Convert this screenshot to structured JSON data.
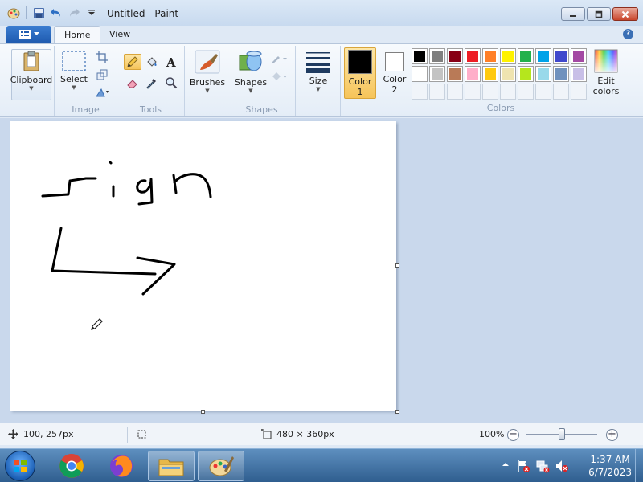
{
  "window": {
    "title": "Untitled - Paint",
    "controls": [
      "minimize-icon",
      "maximize-icon",
      "close-icon"
    ]
  },
  "quick_access": [
    "paint-app-icon",
    "save-icon",
    "undo-icon",
    "redo-icon",
    "customize-dropdown-icon"
  ],
  "tabs": [
    {
      "label": "Home",
      "active": true
    },
    {
      "label": "View",
      "active": false
    }
  ],
  "ribbon": {
    "clipboard": {
      "button_label": "Clipboard"
    },
    "image": {
      "group_label": "Image",
      "select_label": "Select"
    },
    "tools": {
      "group_label": "Tools",
      "active_tool": "pencil"
    },
    "brushes": {
      "label": "Brushes"
    },
    "shapes": {
      "group_label": "Shapes",
      "label": "Shapes"
    },
    "size": {
      "label": "Size"
    },
    "color1": {
      "label": "Color",
      "number": "1",
      "color": "#000000"
    },
    "color2": {
      "label": "Color",
      "number": "2",
      "color": "#ffffff"
    },
    "colors": {
      "group_label": "Colors",
      "row1": [
        "#000000",
        "#7f7f7f",
        "#880015",
        "#ed1c24",
        "#ff7f27",
        "#fff200",
        "#22b14c",
        "#00a2e8",
        "#3f48cc",
        "#a349a4"
      ],
      "row2": [
        "#ffffff",
        "#c3c3c3",
        "#b97a57",
        "#ffaec9",
        "#ffc90e",
        "#efe4b0",
        "#b5e61d",
        "#99d9ea",
        "#7092be",
        "#c8bfe7"
      ],
      "row3_empty": 10
    },
    "edit_colors": {
      "label": "Edit",
      "label2": "colors"
    }
  },
  "status": {
    "cursor_position": "100, 257px",
    "canvas_size": "480 × 360px",
    "zoom": "100%",
    "zoom_level": 1.0
  },
  "taskbar": {
    "apps": [
      "chrome-icon",
      "firefox-icon",
      "file-explorer-icon",
      "paint-icon"
    ],
    "time": "1:37 AM",
    "date": "6/7/2023"
  }
}
